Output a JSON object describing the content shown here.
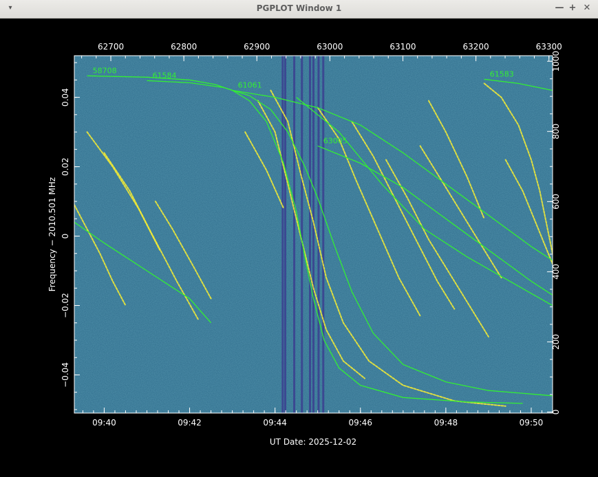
{
  "window": {
    "title": "PGPLOT Window 1",
    "controls": {
      "menu": "▾",
      "minimize": "—",
      "maximize": "+",
      "close": "✕"
    }
  },
  "chart_data": {
    "type": "scatter",
    "title": "",
    "xlabel": "UT Date: 2025-12-02",
    "ylabel": "Frequency − 2010.501 MHz",
    "x_ticks": [
      "09:40",
      "09:42",
      "09:44",
      "09:46",
      "09:48",
      "09:50"
    ],
    "x_range_minutes": [
      39.3,
      50.5
    ],
    "y_ticks": [
      "−0.04",
      "−0.02",
      "0",
      "0.02",
      "0.04"
    ],
    "y_tick_values": [
      -0.04,
      -0.02,
      0,
      0.02,
      0.04
    ],
    "ylim": [
      -0.051,
      0.052
    ],
    "top_ticks": [
      "62700",
      "62800",
      "62900",
      "63000",
      "63100",
      "63200",
      "63300"
    ],
    "top_tick_values": [
      62700,
      62800,
      62900,
      63000,
      63100,
      63200,
      63300
    ],
    "top_range": [
      62650,
      63305
    ],
    "right_ticks": [
      "0",
      "200",
      "400",
      "600",
      "800",
      "1000"
    ],
    "right_tick_values": [
      0,
      200,
      400,
      600,
      800,
      1000
    ],
    "right_range": [
      -3,
      1016
    ],
    "background_color": "#2f6d8c",
    "labeled_tracks_color": "#33ee33",
    "signals_color": "#f2ea35",
    "labeled_tracks": [
      {
        "label": "58708",
        "points": [
          [
            39.6,
            0.0462
          ],
          [
            41.0,
            0.0458
          ],
          [
            42.0,
            0.045
          ],
          [
            42.6,
            0.0437
          ],
          [
            43.0,
            0.042
          ],
          [
            43.4,
            0.039
          ],
          [
            43.8,
            0.033
          ],
          [
            44.2,
            0.021
          ],
          [
            44.5,
            0.007
          ],
          [
            44.7,
            -0.006
          ],
          [
            44.9,
            -0.018
          ],
          [
            45.15,
            -0.03
          ],
          [
            45.5,
            -0.038
          ],
          [
            46.0,
            -0.043
          ],
          [
            47.0,
            -0.0465
          ],
          [
            48.5,
            -0.0478
          ],
          [
            49.8,
            -0.0482
          ]
        ]
      },
      {
        "label": "61584",
        "points": [
          [
            41.0,
            0.0448
          ],
          [
            42.0,
            0.0442
          ],
          [
            42.8,
            0.0428
          ],
          [
            43.4,
            0.0405
          ],
          [
            43.9,
            0.0365
          ],
          [
            44.3,
            0.03
          ],
          [
            44.7,
            0.02
          ],
          [
            45.0,
            0.011
          ],
          [
            45.4,
            -0.003
          ],
          [
            45.8,
            -0.016
          ],
          [
            46.3,
            -0.028
          ],
          [
            47.0,
            -0.037
          ],
          [
            48.0,
            -0.042
          ],
          [
            49.0,
            -0.0445
          ],
          [
            50.5,
            -0.046
          ]
        ]
      },
      {
        "label": "61061",
        "points": [
          [
            43.0,
            0.042
          ],
          [
            44.0,
            0.04
          ],
          [
            45.0,
            0.037
          ],
          [
            46.0,
            0.032
          ],
          [
            47.0,
            0.024
          ],
          [
            48.0,
            0.015
          ],
          [
            49.0,
            0.006
          ],
          [
            50.0,
            -0.003
          ],
          [
            50.5,
            -0.007
          ]
        ]
      },
      {
        "label": "63005",
        "points": [
          [
            45.0,
            0.026
          ],
          [
            46.0,
            0.021
          ],
          [
            47.0,
            0.014
          ],
          [
            48.0,
            0.005
          ],
          [
            49.0,
            -0.004
          ],
          [
            50.0,
            -0.013
          ],
          [
            50.5,
            -0.017
          ]
        ]
      },
      {
        "label": "61583",
        "points": [
          [
            48.9,
            0.0452
          ],
          [
            49.7,
            0.044
          ],
          [
            50.5,
            0.042
          ]
        ]
      },
      {
        "label": "",
        "points": [
          [
            39.3,
            0.004
          ],
          [
            40.0,
            -0.002
          ],
          [
            41.0,
            -0.01
          ],
          [
            42.0,
            -0.018
          ],
          [
            42.5,
            -0.025
          ]
        ]
      },
      {
        "label": "",
        "points": [
          [
            44.5,
            0.04
          ],
          [
            45.5,
            0.03
          ],
          [
            46.5,
            0.015
          ],
          [
            47.5,
            0.002
          ],
          [
            48.5,
            -0.006
          ],
          [
            49.5,
            -0.013
          ],
          [
            50.5,
            -0.02
          ]
        ]
      }
    ],
    "signal_tracks": [
      {
        "points": [
          [
            39.3,
            0.009
          ],
          [
            39.6,
            0.002
          ],
          [
            39.9,
            -0.005
          ],
          [
            40.2,
            -0.013
          ],
          [
            40.5,
            -0.02
          ]
        ]
      },
      {
        "points": [
          [
            39.6,
            0.03
          ],
          [
            40.2,
            0.02
          ],
          [
            40.8,
            0.008
          ],
          [
            41.3,
            -0.004
          ]
        ]
      },
      {
        "points": [
          [
            40.0,
            0.024
          ],
          [
            40.6,
            0.013
          ],
          [
            41.1,
            0.001
          ],
          [
            41.7,
            -0.013
          ],
          [
            42.2,
            -0.024
          ]
        ]
      },
      {
        "points": [
          [
            41.2,
            0.01
          ],
          [
            41.6,
            0.002
          ],
          [
            42.1,
            -0.009
          ],
          [
            42.5,
            -0.018
          ]
        ]
      },
      {
        "points": [
          [
            43.6,
            0.039
          ],
          [
            44.0,
            0.03
          ],
          [
            44.3,
            0.015
          ],
          [
            44.6,
            0.0
          ],
          [
            44.9,
            -0.015
          ],
          [
            45.2,
            -0.027
          ],
          [
            45.6,
            -0.036
          ],
          [
            46.1,
            -0.041
          ]
        ]
      },
      {
        "points": [
          [
            43.9,
            0.042
          ],
          [
            44.3,
            0.033
          ],
          [
            44.6,
            0.018
          ],
          [
            44.9,
            0.004
          ],
          [
            45.2,
            -0.012
          ],
          [
            45.6,
            -0.025
          ],
          [
            46.2,
            -0.036
          ],
          [
            47.0,
            -0.043
          ],
          [
            48.2,
            -0.0475
          ],
          [
            49.4,
            -0.049
          ]
        ]
      },
      {
        "points": [
          [
            45.0,
            0.037
          ],
          [
            45.5,
            0.028
          ],
          [
            45.9,
            0.016
          ],
          [
            46.4,
            0.002
          ],
          [
            46.9,
            -0.012
          ],
          [
            47.4,
            -0.023
          ]
        ]
      },
      {
        "points": [
          [
            45.8,
            0.033
          ],
          [
            46.3,
            0.023
          ],
          [
            46.8,
            0.011
          ],
          [
            47.3,
            -0.001
          ],
          [
            47.8,
            -0.013
          ],
          [
            48.2,
            -0.021
          ]
        ]
      },
      {
        "points": [
          [
            46.6,
            0.022
          ],
          [
            47.1,
            0.011
          ],
          [
            47.6,
            -0.001
          ],
          [
            48.1,
            -0.011
          ],
          [
            48.6,
            -0.021
          ],
          [
            49.0,
            -0.029
          ]
        ]
      },
      {
        "points": [
          [
            47.4,
            0.026
          ],
          [
            47.9,
            0.016
          ],
          [
            48.4,
            0.006
          ],
          [
            48.9,
            -0.004
          ],
          [
            49.3,
            -0.012
          ]
        ]
      },
      {
        "points": [
          [
            48.9,
            0.044
          ],
          [
            49.3,
            0.04
          ],
          [
            49.7,
            0.032
          ],
          [
            50.0,
            0.022
          ],
          [
            50.2,
            0.013
          ],
          [
            50.35,
            0.004
          ],
          [
            50.5,
            -0.005
          ]
        ]
      },
      {
        "points": [
          [
            49.4,
            0.022
          ],
          [
            49.8,
            0.013
          ],
          [
            50.1,
            0.004
          ],
          [
            50.4,
            -0.005
          ],
          [
            50.5,
            -0.008
          ]
        ]
      },
      {
        "points": [
          [
            47.6,
            0.039
          ],
          [
            48.0,
            0.03
          ],
          [
            48.5,
            0.017
          ],
          [
            48.9,
            0.005
          ]
        ]
      },
      {
        "points": [
          [
            43.3,
            0.03
          ],
          [
            43.8,
            0.019
          ],
          [
            44.2,
            0.008
          ]
        ]
      }
    ],
    "vertical_dark_lines_minutes": [
      44.18,
      44.24,
      44.45,
      44.63,
      44.82,
      44.9,
      45.02,
      45.13
    ],
    "grid": false
  }
}
